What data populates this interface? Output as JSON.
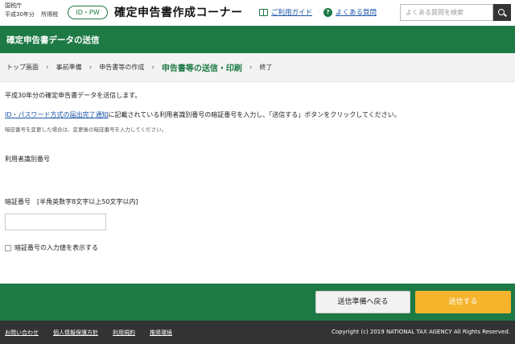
{
  "header": {
    "agency_line1": "国税庁",
    "agency_line2a": "平成30年分",
    "agency_line2b": "所得税",
    "badge": "ID・PW",
    "title": "確定申告書作成コーナー",
    "guide_link": "ご利用ガイド",
    "faq_link": "よくある質問",
    "search_placeholder": "よくある質問を検索",
    "icons": {
      "guide": "book-icon",
      "faq": "question-icon",
      "search": "search-icon"
    }
  },
  "band": {
    "title": "確定申告書データの送信"
  },
  "breadcrumb": {
    "items": [
      "トップ画面",
      "事前準備",
      "申告書等の作成",
      "申告書等の送信・印刷",
      "終了"
    ],
    "active_index": 3,
    "separator": "›"
  },
  "main": {
    "intro": "平成30年分の確定申告書データを送信します。",
    "instruction_link": "ID・パスワード方式の届出完了通知",
    "instruction_rest": "に記載されている利用者識別番号の暗証番号を入力し、「送信する」ボタンをクリックしてください。",
    "note": "暗証番号を変更した場合は、変更後の暗証番号を入力してください。",
    "user_id_label": "利用者識別番号",
    "password_label": "暗証番号　[半角英数字8文字以上50文字以内]",
    "password_value": "",
    "show_password_label": "暗証番号の入力値を表示する"
  },
  "actions": {
    "back_label": "送信準備へ戻る",
    "send_label": "送信する"
  },
  "footer": {
    "links": [
      "お問い合わせ",
      "個人情報保護方針",
      "利用規約",
      "推奨環境"
    ],
    "copyright": "Copyright (c) 2019 NATIONAL TAX AGENCY All Rights Reserved."
  },
  "colors": {
    "brand_green": "#1e7a45",
    "send_orange": "#f5b42c",
    "link_blue": "#1a55a8",
    "footer_dark": "#333333"
  }
}
